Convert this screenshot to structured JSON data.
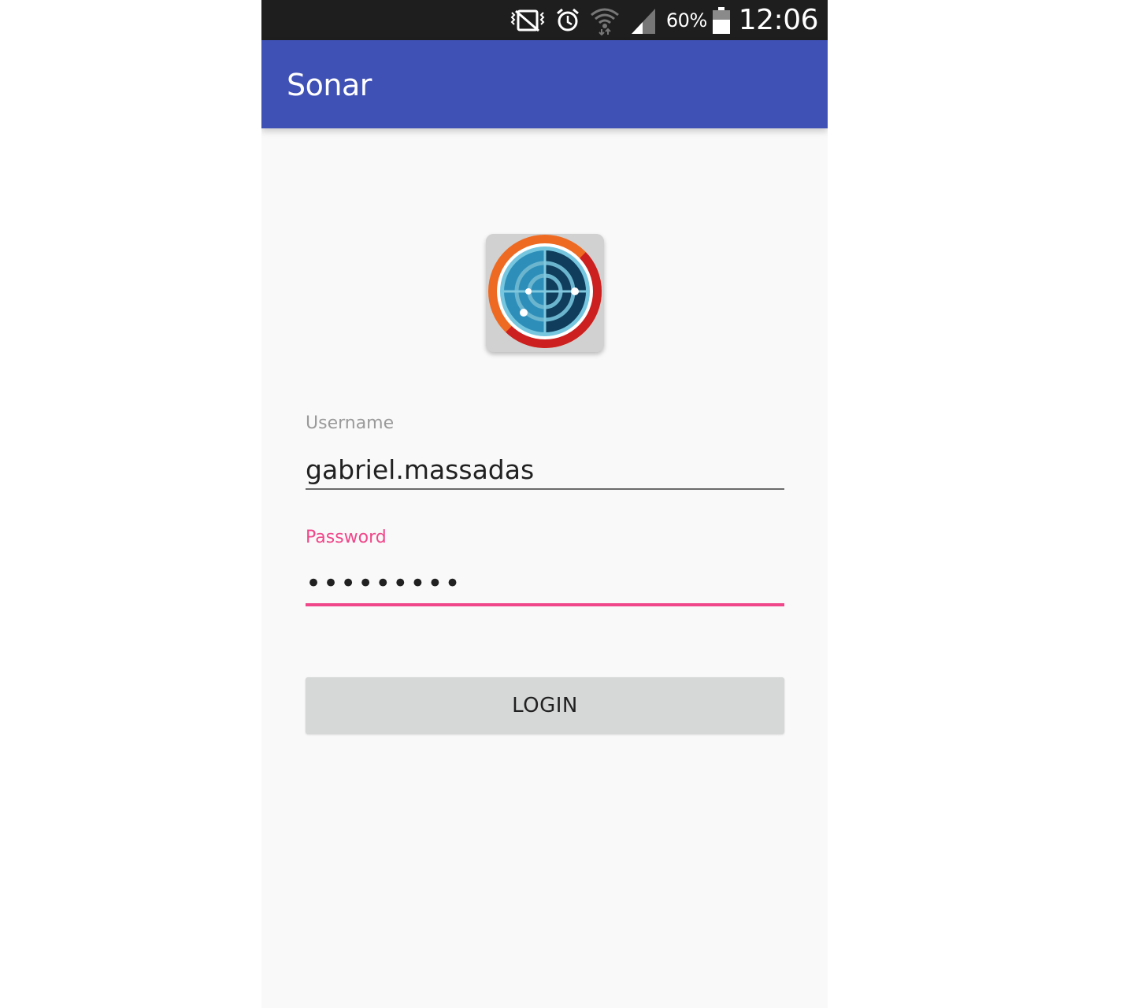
{
  "status_bar": {
    "battery_text": "60%",
    "time": "12:06",
    "icons": [
      "vibrate-icon",
      "alarm-icon",
      "wifi-icon",
      "signal-icon",
      "battery-icon"
    ]
  },
  "app_bar": {
    "title": "Sonar",
    "color": "#4051b5"
  },
  "logo": {
    "icon": "radar-icon"
  },
  "form": {
    "username": {
      "label": "Username",
      "value": "gabriel.massadas"
    },
    "password": {
      "label": "Password",
      "value": "•••••••••",
      "accent_color": "#f0478a"
    },
    "login_label": "LOGIN"
  }
}
